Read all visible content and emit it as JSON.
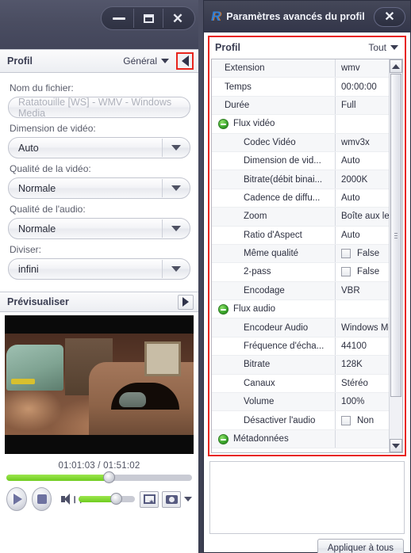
{
  "left_window": {
    "window_controls": {
      "minimize": "minimize-icon",
      "maximize": "maximize-icon",
      "close": "close-icon"
    },
    "profil_header": {
      "title": "Profil",
      "dropdown_label": "Général",
      "collapse_icon": "triangle-left-icon"
    },
    "fields": [
      {
        "label": "Nom du fichier:",
        "value": "Ratatouille [WS] - WMV - Windows Media",
        "type": "text",
        "readonly": true
      },
      {
        "label": "Dimension de vidéo:",
        "value": "Auto",
        "type": "select"
      },
      {
        "label": "Qualité de la vidéo:",
        "value": "Normale",
        "type": "select"
      },
      {
        "label": "Qualité de l'audio:",
        "value": "Normale",
        "type": "select"
      },
      {
        "label": "Diviser:",
        "value": "infini",
        "type": "select"
      }
    ],
    "preview": {
      "title": "Prévisualiser",
      "expand_icon": "triangle-right-icon",
      "time_display": "01:01:03 / 01:51:02",
      "seek_percent": 55,
      "volume_percent": 66,
      "buttons": {
        "play": "play-icon",
        "stop": "stop-icon",
        "volume": "speaker-icon",
        "snapshot_clip": "film-snapshot-icon",
        "snapshot_photo": "camera-icon",
        "snapshot_menu": "caret-down-icon"
      }
    }
  },
  "right_window": {
    "title": "Paramètres avancés du profil",
    "logo": "rosetta-r-logo",
    "close_icon": "close-icon",
    "profil_bar": {
      "title": "Profil",
      "filter_label": "Tout"
    },
    "highlight_color": "#e8251d",
    "table": {
      "rows": [
        {
          "name": "Extension",
          "value": "wmv",
          "indent": 1,
          "group": false
        },
        {
          "name": "Temps",
          "value": "00:00:00",
          "indent": 1,
          "group": false
        },
        {
          "name": "Durée",
          "value": "Full",
          "indent": 1,
          "group": false
        },
        {
          "name": "Flux vidéo",
          "value": "",
          "indent": 0,
          "group": true
        },
        {
          "name": "Codec Vidéo",
          "value": "wmv3x",
          "indent": 2,
          "group": false
        },
        {
          "name": "Dimension de vid...",
          "value": "Auto",
          "indent": 2,
          "group": false
        },
        {
          "name": "Bitrate(débit binai...",
          "value": "2000K",
          "indent": 2,
          "group": false
        },
        {
          "name": "Cadence de diffu...",
          "value": "Auto",
          "indent": 2,
          "group": false
        },
        {
          "name": "Zoom",
          "value": "Boîte aux lettr",
          "indent": 2,
          "group": false
        },
        {
          "name": "Ratio d'Aspect",
          "value": "Auto",
          "indent": 2,
          "group": false
        },
        {
          "name": "Même qualité",
          "value": "False",
          "indent": 2,
          "group": false,
          "checkbox": true
        },
        {
          "name": "2-pass",
          "value": "False",
          "indent": 2,
          "group": false,
          "checkbox": true
        },
        {
          "name": "Encodage",
          "value": "VBR",
          "indent": 2,
          "group": false
        },
        {
          "name": "Flux audio",
          "value": "",
          "indent": 0,
          "group": true
        },
        {
          "name": "Encodeur Audio",
          "value": "Windows Me",
          "indent": 2,
          "group": false
        },
        {
          "name": "Fréquence d'écha...",
          "value": "44100",
          "indent": 2,
          "group": false
        },
        {
          "name": "Bitrate",
          "value": "128K",
          "indent": 2,
          "group": false
        },
        {
          "name": "Canaux",
          "value": "Stéréo",
          "indent": 2,
          "group": false
        },
        {
          "name": "Volume",
          "value": "100%",
          "indent": 2,
          "group": false
        },
        {
          "name": "Désactiver l'audio",
          "value": "Non",
          "indent": 2,
          "group": false,
          "checkbox": true
        },
        {
          "name": "Métadonnées",
          "value": "",
          "indent": 0,
          "group": true
        }
      ]
    },
    "scrollbar": {
      "up_icon": "scroll-up-icon",
      "down_icon": "scroll-down-icon"
    },
    "description_box": "",
    "apply_button": "Appliquer à tous"
  }
}
